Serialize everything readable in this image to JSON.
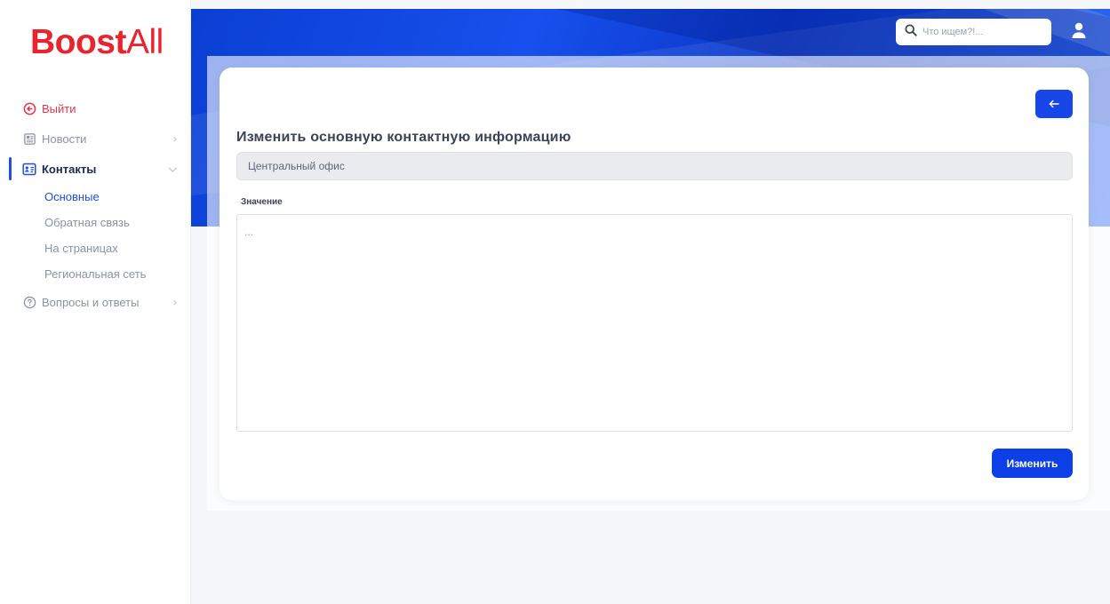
{
  "brand": {
    "name_bold": "Boost",
    "name_thin": "All",
    "color": "#e8252e"
  },
  "sidebar": {
    "items": [
      {
        "label": "Выйти",
        "icon": "logout-icon"
      },
      {
        "label": "Новости",
        "icon": "newspaper-icon"
      },
      {
        "label": "Контакты",
        "icon": "contact-card-icon",
        "active": true,
        "children": [
          {
            "label": "Основные",
            "current": true
          },
          {
            "label": "Обратная связь"
          },
          {
            "label": "На страницах"
          },
          {
            "label": "Региональная сеть"
          }
        ]
      },
      {
        "label": "Вопросы и ответы",
        "icon": "question-icon"
      }
    ]
  },
  "header": {
    "search": {
      "placeholder": "Что ищем?!..."
    },
    "user_icon": "user-icon"
  },
  "form": {
    "back_icon": "arrow-left-icon",
    "title": "Изменить основную контактную информацию",
    "name_value": "Центральный офис",
    "value_label": "Значение",
    "value_text": "...",
    "submit_label": "Изменить"
  },
  "colors": {
    "accent": "#1747e8",
    "logout": "#e8344a",
    "text_dark": "#3a4358"
  }
}
